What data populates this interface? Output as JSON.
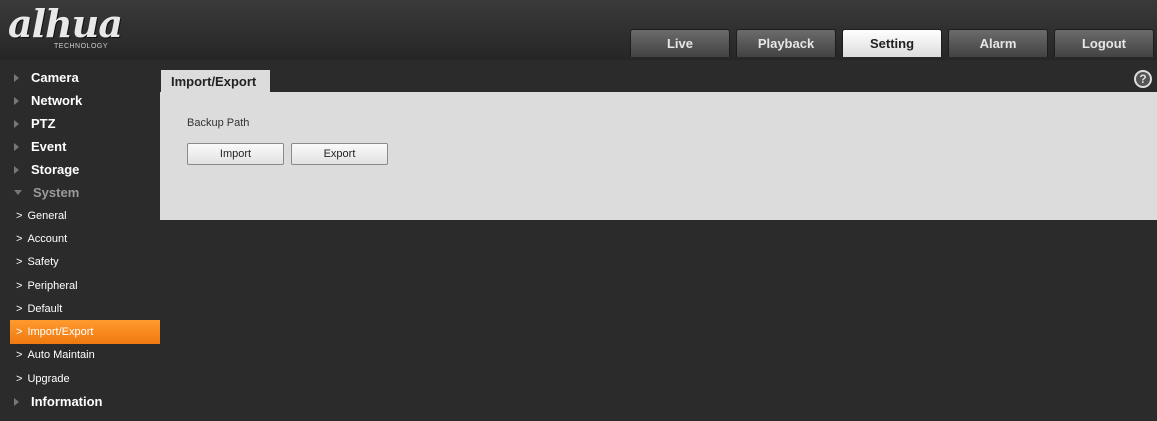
{
  "logo": {
    "main": "alhua",
    "sub": "TECHNOLOGY"
  },
  "nav_tabs": [
    {
      "label": "Live",
      "active": false
    },
    {
      "label": "Playback",
      "active": false
    },
    {
      "label": "Setting",
      "active": true
    },
    {
      "label": "Alarm",
      "active": false
    },
    {
      "label": "Logout",
      "active": false
    }
  ],
  "sidebar": {
    "items": [
      {
        "label": "Camera"
      },
      {
        "label": "Network"
      },
      {
        "label": "PTZ"
      },
      {
        "label": "Event"
      },
      {
        "label": "Storage"
      },
      {
        "label": "System"
      },
      {
        "label": "Information"
      }
    ],
    "system_subitems": [
      {
        "label": "General"
      },
      {
        "label": "Account"
      },
      {
        "label": "Safety"
      },
      {
        "label": "Peripheral"
      },
      {
        "label": "Default"
      },
      {
        "label": "Import/Export"
      },
      {
        "label": "Auto Maintain"
      },
      {
        "label": "Upgrade"
      }
    ]
  },
  "content": {
    "tab_title": "Import/Export",
    "backup_path_label": "Backup Path",
    "import_button": "Import",
    "export_button": "Export"
  },
  "help_icon": "?",
  "chevron": ">",
  "colors": {
    "accent": "#f28a1c",
    "panel": "#dcdcdc",
    "background": "#2b2b2b"
  }
}
